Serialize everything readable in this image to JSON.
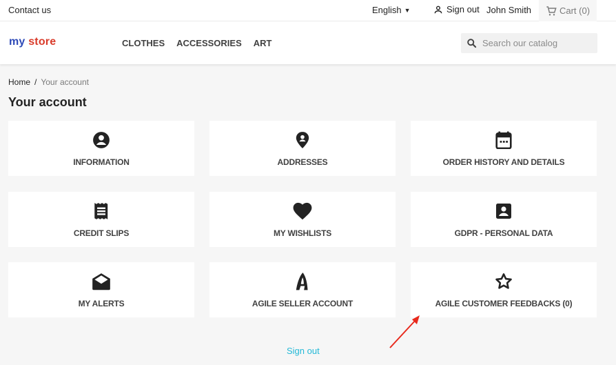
{
  "topbar": {
    "contact": "Contact us",
    "language": "English",
    "signout": "Sign out",
    "user": "John Smith",
    "cart": "Cart (0)"
  },
  "header": {
    "logo_part1": "my",
    "logo_part2": "store",
    "nav": [
      "CLOTHES",
      "ACCESSORIES",
      "ART"
    ],
    "search_placeholder": "Search our catalog"
  },
  "breadcrumb": {
    "home": "Home",
    "separator": "/",
    "current": "Your account"
  },
  "page_title": "Your account",
  "cards": [
    {
      "label": "INFORMATION",
      "icon": "account-circle-icon"
    },
    {
      "label": "ADDRESSES",
      "icon": "location-pin-icon"
    },
    {
      "label": "ORDER HISTORY AND DETAILS",
      "icon": "calendar-icon"
    },
    {
      "label": "CREDIT SLIPS",
      "icon": "receipt-icon"
    },
    {
      "label": "MY WISHLISTS",
      "icon": "heart-icon"
    },
    {
      "label": "GDPR - PERSONAL DATA",
      "icon": "contact-card-icon"
    },
    {
      "label": "MY ALERTS",
      "icon": "open-envelope-icon"
    },
    {
      "label": "AGILE SELLER ACCOUNT",
      "icon": "agile-logo-icon"
    },
    {
      "label": "AGILE CUSTOMER FEEDBACKS (0)",
      "icon": "star-outline-icon"
    }
  ],
  "signout_link": "Sign out",
  "colors": {
    "accent": "#24b9d7",
    "logo_blue": "#2f4bb8",
    "logo_red": "#d93b2a",
    "annotation": "#e8291c"
  }
}
